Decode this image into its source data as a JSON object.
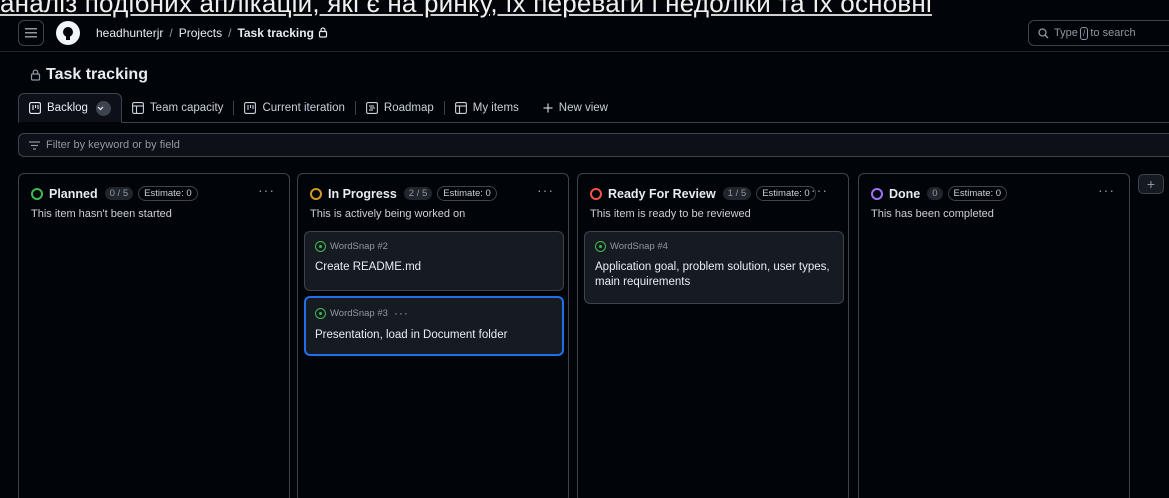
{
  "overlay_text": "аналіз подібних аплікацій, які є на ринку, їх переваги і недоліки та їх основні",
  "header": {
    "breadcrumb": [
      "headhunterjr",
      "Projects",
      "Task tracking"
    ],
    "search_pre": "Type",
    "search_key": "/",
    "search_post": "to search"
  },
  "project": {
    "title": "Task tracking"
  },
  "tabs": [
    {
      "label": "Backlog",
      "icon": "board-icon"
    },
    {
      "label": "Team capacity",
      "icon": "table-icon"
    },
    {
      "label": "Current iteration",
      "icon": "board-icon"
    },
    {
      "label": "Roadmap",
      "icon": "roadmap-icon"
    },
    {
      "label": "My items",
      "icon": "table-icon"
    },
    {
      "label": "New view",
      "icon": "plus-icon"
    }
  ],
  "filter": {
    "placeholder": "Filter by keyword or by field"
  },
  "columns": [
    {
      "name": "Planned",
      "count": "0 / 5",
      "estimate": "Estimate: 0",
      "color": "#3fb950",
      "description": "This item hasn't been started",
      "cards": []
    },
    {
      "name": "In Progress",
      "count": "2 / 5",
      "estimate": "Estimate: 0",
      "color": "#d29922",
      "description": "This is actively being worked on",
      "cards": [
        {
          "ref": "WordSnap #2",
          "title": "Create README.md"
        },
        {
          "ref": "WordSnap #3",
          "title": "Presentation, load in Document folder"
        }
      ]
    },
    {
      "name": "Ready For Review",
      "count": "1 / 5",
      "estimate": "Estimate: 0",
      "color": "#f85149",
      "description": "This item is ready to be reviewed",
      "cards": [
        {
          "ref": "WordSnap #4",
          "title": "Application goal, problem solution, user types, main requirements"
        }
      ]
    },
    {
      "name": "Done",
      "count": "0",
      "estimate": "Estimate: 0",
      "color": "#a371f7",
      "description": "This has been completed",
      "cards": []
    }
  ],
  "column_menu": "···",
  "add_column": "+"
}
